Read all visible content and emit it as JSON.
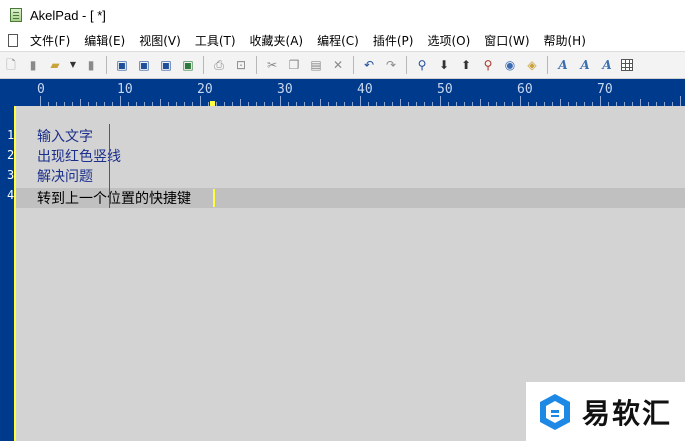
{
  "window": {
    "title": "AkelPad - [ *]"
  },
  "menu": {
    "items": [
      "文件(F)",
      "编辑(E)",
      "视图(V)",
      "工具(T)",
      "收藏夹(A)",
      "编程(C)",
      "插件(P)",
      "选项(O)",
      "窗口(W)",
      "帮助(H)"
    ]
  },
  "toolbar": {
    "icons": [
      "new-file-icon",
      "new-doc-icon",
      "open-folder-icon",
      "dropdown-arrow-icon",
      "close-doc-icon",
      "save-icon",
      "save-as-icon",
      "save-all-icon",
      "save-session-icon",
      "print-icon",
      "print-preview-icon",
      "cut-icon",
      "copy-icon",
      "paste-icon",
      "delete-icon",
      "undo-icon",
      "redo-icon",
      "find-icon",
      "find-next-icon",
      "find-prev-icon",
      "replace-icon",
      "goto-icon",
      "bookmark-icon",
      "font-icon",
      "font-bold-icon",
      "font-color-icon",
      "grid-icon"
    ]
  },
  "ruler": {
    "labels": [
      "0",
      "10",
      "20",
      "30",
      "40",
      "50",
      "60",
      "70"
    ]
  },
  "editor": {
    "line_numbers": [
      "1",
      "2",
      "3",
      "4"
    ],
    "lines": [
      "输入文字",
      "出现红色竖线",
      "解决问题",
      "转到上一个位置的快捷键"
    ],
    "current_line_index": 3
  },
  "colors": {
    "frame": "#003a8c",
    "text_bg": "#d3d3d3",
    "current_line_bg": "#c0c0c0",
    "text": "#1b2f8c",
    "marker_line": "#e02020",
    "caret": "#ffff40"
  },
  "watermark": {
    "text": "易软汇"
  }
}
